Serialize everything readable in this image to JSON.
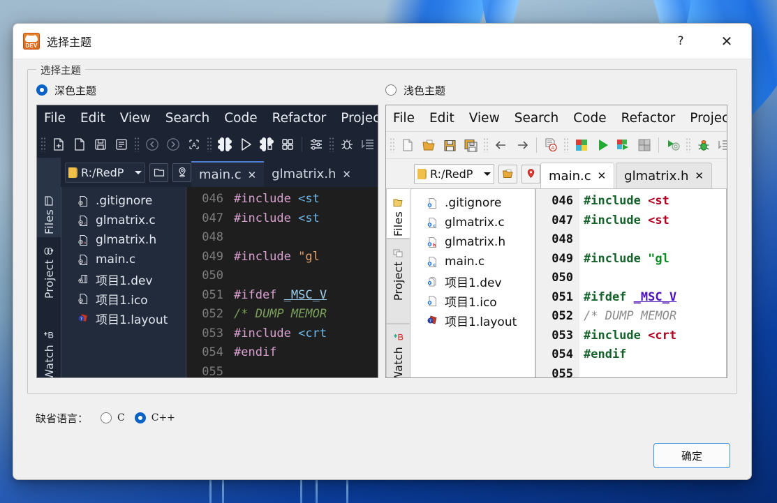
{
  "window": {
    "title": "选择主题",
    "app_icon": "dev-cpp-icon",
    "icon_text": "DEV",
    "help_button": "?",
    "close_button": "✕"
  },
  "groupbox": {
    "label": "选择主题"
  },
  "themes": [
    {
      "id": "dark",
      "radio_label": "深色主题",
      "selected": true,
      "menu": [
        "File",
        "Edit",
        "View",
        "Search",
        "Code",
        "Refactor",
        "Project"
      ],
      "toolbar_icons": [
        "new-file-icon",
        "open-file-icon",
        "save-icon",
        "save-all-icon",
        "back-arrow-icon",
        "forward-arrow-icon",
        "find-text-icon",
        "compile-icon",
        "run-icon",
        "compile-run-icon",
        "rebuild-icon",
        "compiler-options-icon",
        "debug-bug-icon",
        "indent-icon"
      ],
      "path_combo": "R:/RedP",
      "path_buttons": [
        "open-folder-icon",
        "locate-icon"
      ],
      "tabs": [
        {
          "label": "main.c",
          "close": "✕",
          "active": true
        },
        {
          "label": "glmatrix.h",
          "close": "✕",
          "active": false
        }
      ],
      "rail_tabs": [
        {
          "label": "Files",
          "icon": "files-icon",
          "selected": true
        },
        {
          "label": "Project",
          "icon": "project-icon",
          "selected": false
        },
        {
          "label": "Watch",
          "icon": "watch-icon",
          "selected": false
        }
      ],
      "files": [
        {
          "name": ".gitignore",
          "icon": "file-plain-icon"
        },
        {
          "name": "glmatrix.c",
          "icon": "file-c-icon"
        },
        {
          "name": "glmatrix.h",
          "icon": "file-h-icon"
        },
        {
          "name": "main.c",
          "icon": "file-c-icon"
        },
        {
          "name": "项目1.dev",
          "icon": "project-dev-icon"
        },
        {
          "name": "项目1.ico",
          "icon": "file-plain-icon"
        },
        {
          "name": "项目1.layout",
          "icon": "layout-icon"
        }
      ],
      "line_numbers": [
        "046",
        "047",
        "048",
        "049",
        "050",
        "051",
        "052",
        "053",
        "054",
        "055"
      ]
    },
    {
      "id": "light",
      "radio_label": "浅色主题",
      "selected": false,
      "menu": [
        "File",
        "Edit",
        "View",
        "Search",
        "Code",
        "Refactor",
        "Project"
      ],
      "toolbar_icons": [
        "new-file-icon",
        "open-file-icon",
        "save-icon",
        "save-all-icon",
        "back-arrow-icon",
        "forward-arrow-icon",
        "find-text-icon",
        "compile-icon",
        "run-icon",
        "compile-run-icon",
        "rebuild-icon",
        "compiler-options-icon",
        "debug-bug-icon",
        "indent-icon"
      ],
      "path_combo": "R:/RedP",
      "path_buttons": [
        "open-folder-icon",
        "locate-icon"
      ],
      "tabs": [
        {
          "label": "main.c",
          "close": "✕",
          "active": true
        },
        {
          "label": "glmatrix.h",
          "close": "✕",
          "active": false
        }
      ],
      "rail_tabs": [
        {
          "label": "Files",
          "icon": "files-icon",
          "selected": true
        },
        {
          "label": "Project",
          "icon": "project-icon",
          "selected": false
        },
        {
          "label": "Watch",
          "icon": "watch-icon",
          "selected": false
        }
      ],
      "files": [
        {
          "name": ".gitignore",
          "icon": "file-plain-icon"
        },
        {
          "name": "glmatrix.c",
          "icon": "file-c-icon"
        },
        {
          "name": "glmatrix.h",
          "icon": "file-h-icon"
        },
        {
          "name": "main.c",
          "icon": "file-c-icon"
        },
        {
          "name": "项目1.dev",
          "icon": "project-dev-icon"
        },
        {
          "name": "项目1.ico",
          "icon": "file-plain-icon"
        },
        {
          "name": "项目1.layout",
          "icon": "layout-icon"
        }
      ],
      "line_numbers": [
        "046",
        "047",
        "048",
        "049",
        "050",
        "051",
        "052",
        "053",
        "054",
        "055"
      ]
    }
  ],
  "code_preview": {
    "lines": [
      {
        "n": "046",
        "tokens": [
          {
            "t": "#include ",
            "c": "pre"
          },
          {
            "t": "<st",
            "c": "str"
          }
        ]
      },
      {
        "n": "047",
        "tokens": [
          {
            "t": "#include ",
            "c": "pre"
          },
          {
            "t": "<st",
            "c": "str"
          }
        ]
      },
      {
        "n": "048",
        "tokens": []
      },
      {
        "n": "049",
        "tokens": [
          {
            "t": "#include ",
            "c": "pre"
          },
          {
            "t": "\"gl",
            "c": "hdr"
          }
        ]
      },
      {
        "n": "050",
        "tokens": []
      },
      {
        "n": "051",
        "tokens": [
          {
            "t": "#ifdef ",
            "c": "pre"
          },
          {
            "t": "_MSC_V",
            "c": "id"
          }
        ]
      },
      {
        "n": "052",
        "tokens": [
          {
            "t": "/* DUMP MEMOR",
            "c": "cmt"
          }
        ]
      },
      {
        "n": "053",
        "tokens": [
          {
            "t": "#include ",
            "c": "pre"
          },
          {
            "t": "<crt",
            "c": "str"
          }
        ]
      },
      {
        "n": "054",
        "tokens": [
          {
            "t": "#endif",
            "c": "pre"
          }
        ]
      },
      {
        "n": "055",
        "tokens": []
      }
    ]
  },
  "language": {
    "label": "缺省语言：",
    "options": [
      {
        "label": "C",
        "selected": false
      },
      {
        "label": "C++",
        "selected": true
      }
    ]
  },
  "footer": {
    "ok_label": "确定"
  },
  "colors": {
    "accent": "#0a62c7",
    "dark_bg": "#1c2433",
    "dark_editor": "#1e1e1e",
    "light_bg": "#f1f1f1",
    "dialog_bg": "#f0f0f0"
  }
}
